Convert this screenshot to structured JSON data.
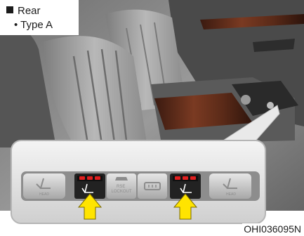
{
  "caption": {
    "section": "Rear",
    "bullet": "•",
    "type": "Type A"
  },
  "image_code": "OHI036095N",
  "panel": {
    "buttons": [
      {
        "id": "left-seat-button",
        "icon": "seat-recline-icon",
        "text": "HEAD"
      },
      {
        "id": "left-heated-seat-button",
        "icon": "heated-seat-icon",
        "text": ""
      },
      {
        "id": "rse-lock-button",
        "icon": "car-icon",
        "text": "RSE\nLOCKOUT"
      },
      {
        "id": "rear-climate-button",
        "icon": "rear-window-icon",
        "text": ""
      },
      {
        "id": "right-heated-seat-button",
        "icon": "heated-seat-icon",
        "text": ""
      },
      {
        "id": "right-seat-button",
        "icon": "seat-recline-icon",
        "text": "HEAD"
      }
    ],
    "indicator_color": "#e02020",
    "arrow_color": "#ffe400"
  }
}
